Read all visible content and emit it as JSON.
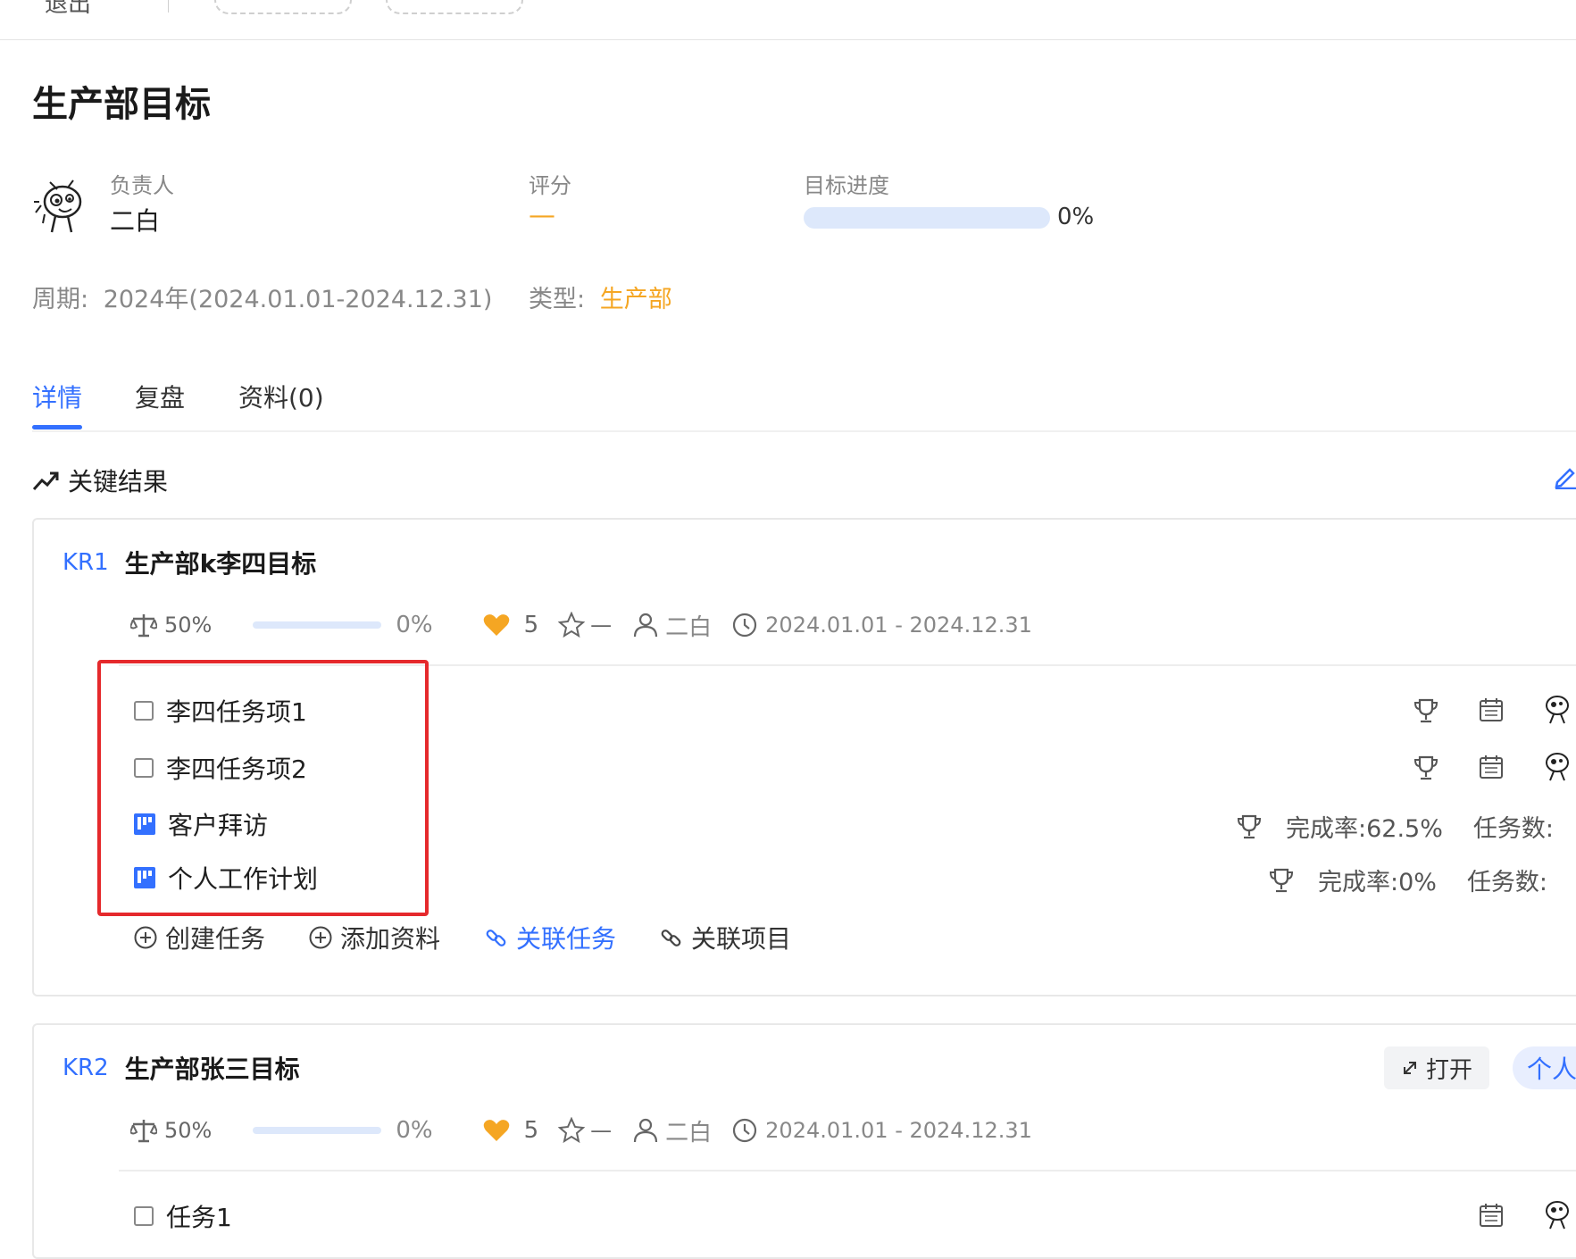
{
  "topbar": {
    "back_label": "退出"
  },
  "page_title": "生产部目标",
  "owner": {
    "label": "负责人",
    "name": "二白"
  },
  "score": {
    "label": "评分",
    "value": "—"
  },
  "goal_progress": {
    "label": "目标进度",
    "value": "0%",
    "fraction": 0
  },
  "period": {
    "label": "周期:",
    "value": "2024年(2024.01.01-2024.12.31)"
  },
  "type": {
    "label": "类型:",
    "value": "生产部"
  },
  "tabs": [
    {
      "label": "详情",
      "active": true
    },
    {
      "label": "复盘",
      "active": false
    },
    {
      "label": "资料(0)",
      "active": false
    }
  ],
  "section": {
    "title": "关键结果"
  },
  "kr1": {
    "tag": "KR1",
    "title": "生产部k李四目标",
    "weight": "50%",
    "progress": "0%",
    "progress_fraction": 0,
    "likes": "5",
    "star_value": "—",
    "owner": "二白",
    "date_range": "2024.01.01 - 2024.12.31",
    "tasks": [
      {
        "label": "李四任务项1",
        "kind": "task"
      },
      {
        "label": "李四任务项2",
        "kind": "task"
      },
      {
        "label": "客户拜访",
        "kind": "project",
        "completion": "完成率:62.5%",
        "task_count": "任务数:"
      },
      {
        "label": "个人工作计划",
        "kind": "project",
        "completion": "完成率:0%",
        "task_count": "任务数:"
      }
    ],
    "actions": {
      "create_task": "创建任务",
      "add_material": "添加资料",
      "link_task": "关联任务",
      "link_project": "关联项目"
    }
  },
  "kr2": {
    "tag": "KR2",
    "title": "生产部张三目标",
    "open_label": "打开",
    "badge": "个人",
    "weight": "50%",
    "progress": "0%",
    "progress_fraction": 0,
    "likes": "5",
    "star_value": "—",
    "owner": "二白",
    "date_range": "2024.01.01 - 2024.12.31",
    "tasks": [
      {
        "label": "任务1",
        "kind": "task"
      }
    ]
  },
  "colors": {
    "accent": "#3370ff",
    "orange": "#f5a623",
    "highlight": "#e5292c"
  }
}
